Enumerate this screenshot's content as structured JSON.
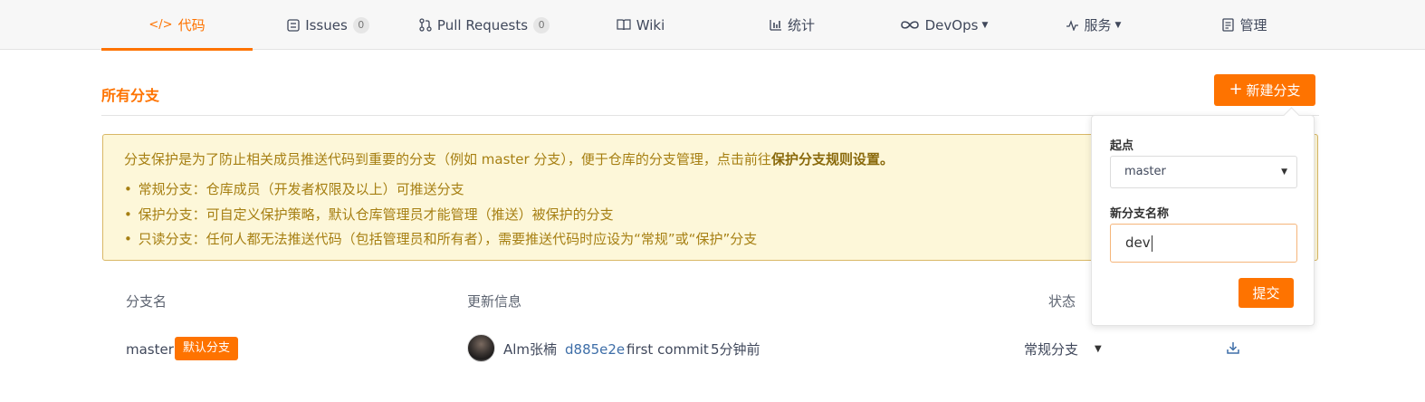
{
  "nav": {
    "tabs": [
      {
        "label": "代码",
        "icon": "code-icon"
      },
      {
        "label": "Issues",
        "count": "0",
        "icon": "issues-icon"
      },
      {
        "label": "Pull Requests",
        "count": "0",
        "icon": "pull-request-icon"
      },
      {
        "label": "Wiki",
        "icon": "book-icon"
      },
      {
        "label": "统计",
        "icon": "bar-chart-icon"
      },
      {
        "label": "DevOps",
        "icon": "infinity-icon"
      },
      {
        "label": "服务",
        "icon": "pulse-icon"
      },
      {
        "label": "管理",
        "icon": "document-icon"
      }
    ]
  },
  "page": {
    "title": "所有分支",
    "new_branch_label": "新建分支"
  },
  "notice": {
    "intro_text": "分支保护是为了防止相关成员推送代码到重要的分支（例如 master 分支），便于仓库的分支管理，点击前往",
    "intro_link": "保护分支规则设置。",
    "items": [
      "常规分支：仓库成员（开发者权限及以上）可推送分支",
      "保护分支：可自定义保护策略，默认仓库管理员才能管理（推送）被保护的分支",
      "只读分支：任何人都无法推送代码（包括管理员和所有者），需要推送代码时应设为“常规”或“保护”分支"
    ]
  },
  "table": {
    "headers": {
      "name": "分支名",
      "update": "更新信息",
      "status": "状态"
    },
    "rows": [
      {
        "name": "master",
        "badge": "默认分支",
        "author": "Alm张楠",
        "sha": "d885e2e",
        "message": "first commit",
        "time": "5分钟前",
        "status": "常规分支"
      }
    ]
  },
  "popover": {
    "origin_label": "起点",
    "origin_value": "master",
    "name_label": "新分支名称",
    "name_value": "dev",
    "submit_label": "提交"
  },
  "colors": {
    "accent": "#fe7300",
    "link": "#3e6ea8",
    "notice_bg": "#fdf7d9",
    "notice_text": "#a67f12"
  }
}
